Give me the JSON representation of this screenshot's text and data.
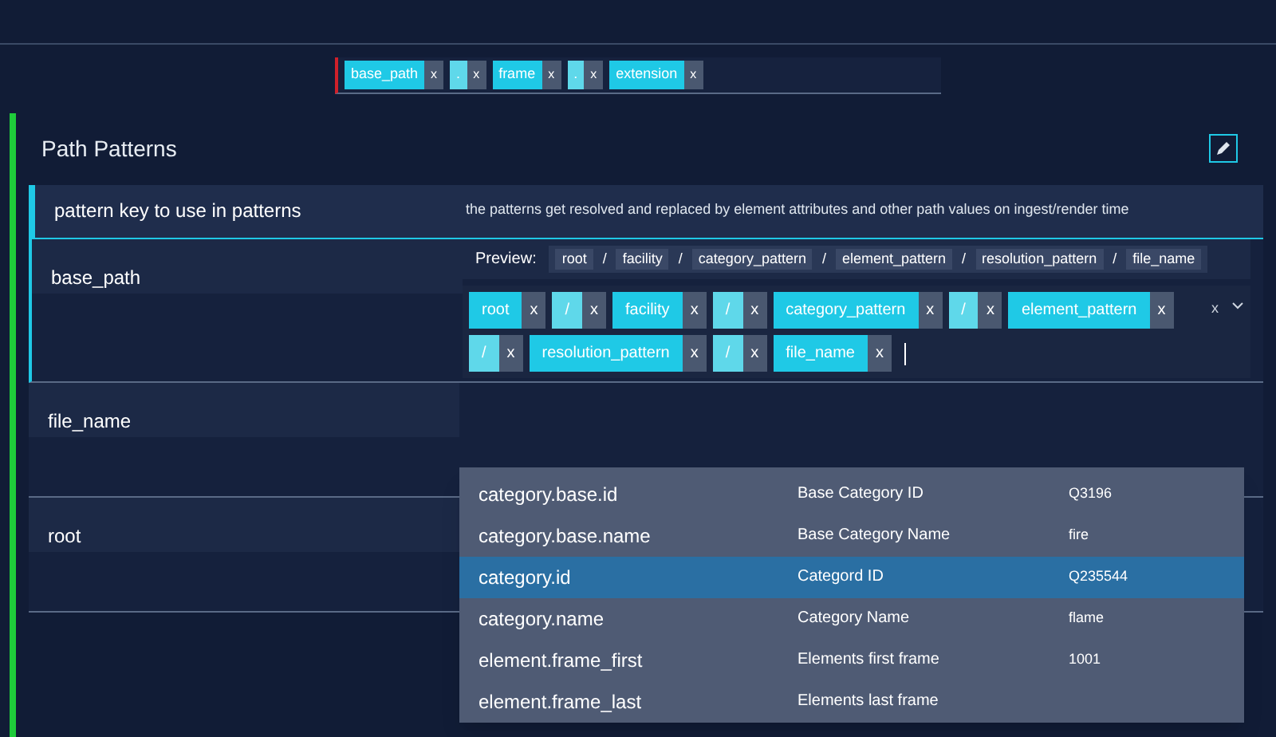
{
  "filename_tokens": [
    {
      "kind": "var",
      "text": "base_path",
      "remove": "x"
    },
    {
      "kind": "sep",
      "text": ".",
      "remove": "x"
    },
    {
      "kind": "var",
      "text": "frame",
      "remove": "x"
    },
    {
      "kind": "sep",
      "text": ".",
      "remove": "x"
    },
    {
      "kind": "var",
      "text": "extension",
      "remove": "x"
    }
  ],
  "panel": {
    "title": "Path Patterns",
    "header": {
      "key": "pattern key to use in patterns",
      "description": "the patterns get resolved and replaced by element attributes and other path values on ingest/render time"
    },
    "rows": [
      {
        "key": "base_path",
        "expanded": true,
        "preview_label": "Preview:",
        "preview": [
          {
            "kind": "var",
            "text": "root"
          },
          {
            "kind": "sep",
            "text": "/"
          },
          {
            "kind": "var",
            "text": "facility"
          },
          {
            "kind": "sep",
            "text": "/"
          },
          {
            "kind": "var",
            "text": "category_pattern"
          },
          {
            "kind": "sep",
            "text": "/"
          },
          {
            "kind": "var",
            "text": "element_pattern"
          },
          {
            "kind": "sep",
            "text": "/"
          },
          {
            "kind": "var",
            "text": "resolution_pattern"
          },
          {
            "kind": "sep",
            "text": "/"
          },
          {
            "kind": "var",
            "text": "file_name"
          }
        ],
        "tokens": [
          {
            "kind": "var",
            "text": "root",
            "remove": "x"
          },
          {
            "kind": "sep",
            "text": "/",
            "remove": "x"
          },
          {
            "kind": "var",
            "text": "facility",
            "remove": "x"
          },
          {
            "kind": "sep",
            "text": "/",
            "remove": "x"
          },
          {
            "kind": "var",
            "text": "category_pattern",
            "remove": "x"
          },
          {
            "kind": "sep",
            "text": "/",
            "remove": "x"
          },
          {
            "kind": "var",
            "text": "element_pattern",
            "remove": "x"
          },
          {
            "kind": "sep",
            "text": "/",
            "remove": "x"
          },
          {
            "kind": "var",
            "text": "resolution_pattern",
            "remove": "x"
          },
          {
            "kind": "sep",
            "text": "/",
            "remove": "x"
          },
          {
            "kind": "var",
            "text": "file_name",
            "remove": "x"
          }
        ],
        "clear": "x"
      },
      {
        "key": "file_name",
        "expanded": false
      },
      {
        "key": "root",
        "expanded": false
      }
    ]
  },
  "dropdown": {
    "options": [
      {
        "key": "category.base.id",
        "label": "Base Category ID",
        "value": "Q3196",
        "selected": false
      },
      {
        "key": "category.base.name",
        "label": "Base Category Name",
        "value": "fire",
        "selected": false
      },
      {
        "key": "category.id",
        "label": "Categord ID",
        "value": "Q235544",
        "selected": true
      },
      {
        "key": "category.name",
        "label": "Category Name",
        "value": "flame",
        "selected": false
      },
      {
        "key": "element.frame_first",
        "label": "Elements first frame",
        "value": "1001",
        "selected": false
      },
      {
        "key": "element.frame_last",
        "label": "Elements last frame",
        "selected": false
      }
    ]
  }
}
